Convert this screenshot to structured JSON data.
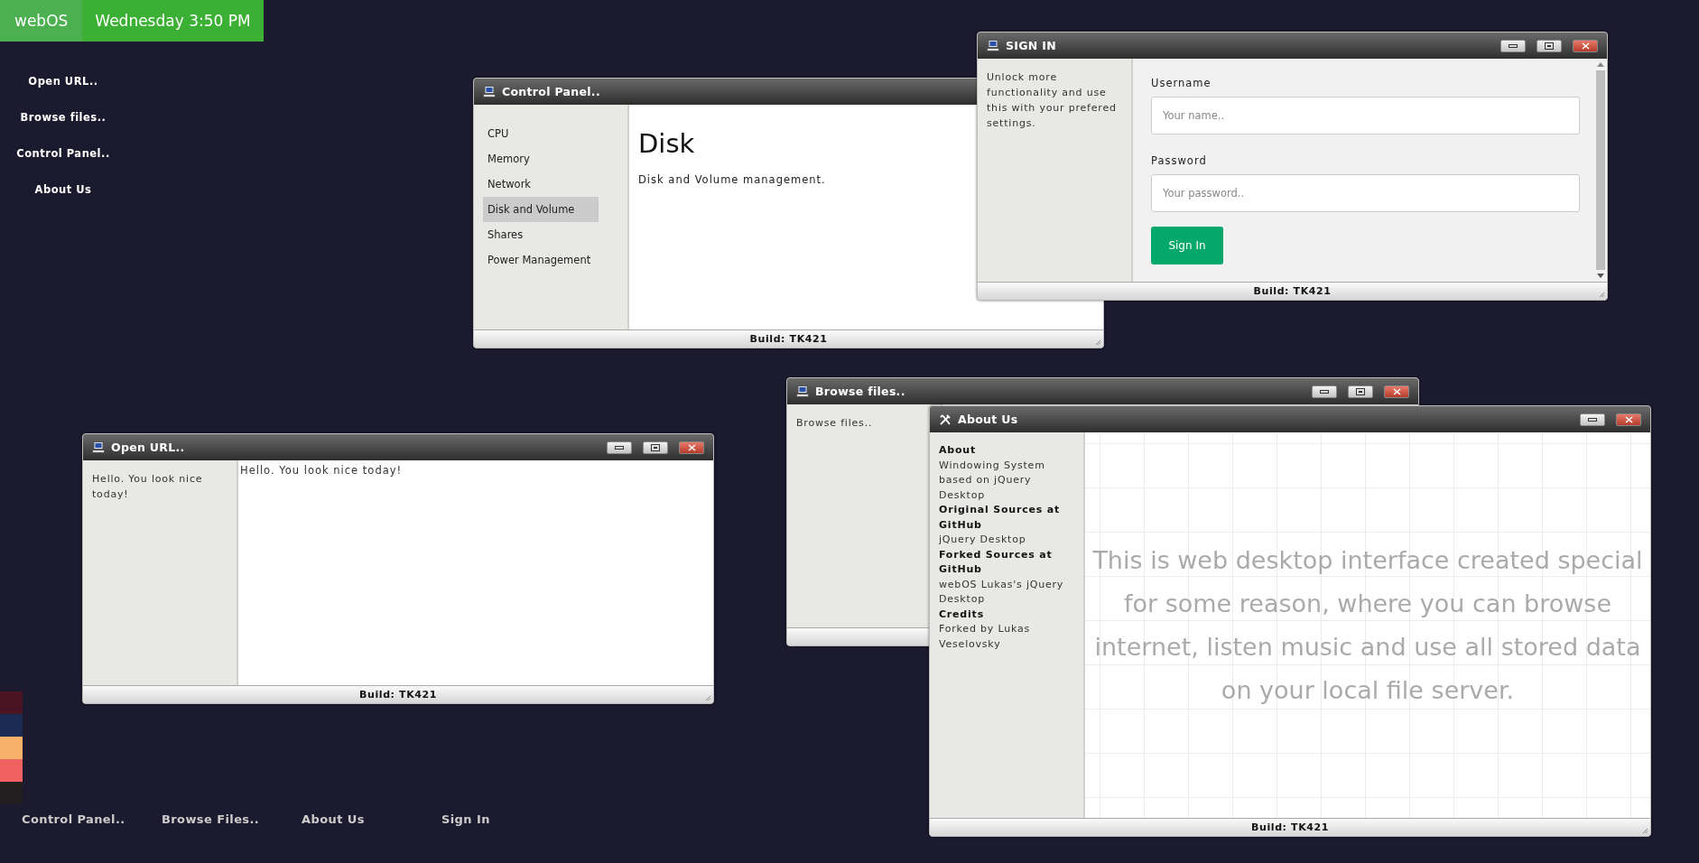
{
  "top_bar": {
    "brand": "webOS",
    "clock": "Wednesday 3:50 PM"
  },
  "desktop_shortcuts": [
    {
      "label": "Open URL.."
    },
    {
      "label": "Browse files.."
    },
    {
      "label": "Control Panel.."
    },
    {
      "label": "About Us"
    }
  ],
  "color_swatches": [
    {
      "color": "#4a1424"
    },
    {
      "color": "#1a2a50"
    },
    {
      "color": "#f6b26b"
    },
    {
      "color": "#f06262"
    },
    {
      "color": "#231f20"
    }
  ],
  "windows": [
    {
      "kind": "control_panel",
      "title": "Control Panel..",
      "menu": [
        {
          "label": "CPU",
          "selected": false
        },
        {
          "label": "Memory",
          "selected": false
        },
        {
          "label": "Network",
          "selected": false
        },
        {
          "label": "Disk and Volume",
          "selected": true
        },
        {
          "label": "Shares",
          "selected": false
        },
        {
          "label": "Power Management",
          "selected": false
        }
      ],
      "heading": "Disk",
      "description": "Disk and Volume management.",
      "footer": "Build: TK421"
    },
    {
      "kind": "sign_in",
      "title": "SIGN IN",
      "sidebar_text": "Unlock more functionality and use this with your prefered settings.",
      "username_label": "Username",
      "username_placeholder": "Your name..",
      "password_label": "Password",
      "password_placeholder": "Your password..",
      "button": "Sign In",
      "footer": "Build: TK421"
    },
    {
      "kind": "text",
      "title": "Open URL..",
      "sidebar_text": "Hello. You look nice today!",
      "content_text": "Hello. You look nice today!",
      "footer": "Build: TK421"
    },
    {
      "kind": "text",
      "title": "Browse files..",
      "sidebar_text": "Browse files.."
    },
    {
      "kind": "about",
      "title": "About Us",
      "sections": [
        {
          "heading": "About",
          "text": "Windowing System based on jQuery Desktop"
        },
        {
          "heading": "Original Sources at GitHub",
          "text": "jQuery Desktop"
        },
        {
          "heading": "Forked Sources at GitHub",
          "text": "webOS Lukas's jQuery Desktop"
        },
        {
          "heading": "Credits",
          "text": "Forked by Lukas Veselovsky"
        }
      ],
      "content_text": "This is web desktop interface created special for some reason, where you can browse internet, listen music and use all stored data on your local file server.",
      "footer": "Build: TK421"
    }
  ],
  "taskbar": [
    {
      "label": "Control Panel.."
    },
    {
      "label": "Browse Files.."
    },
    {
      "label": "About Us"
    },
    {
      "label": "Sign In"
    }
  ]
}
